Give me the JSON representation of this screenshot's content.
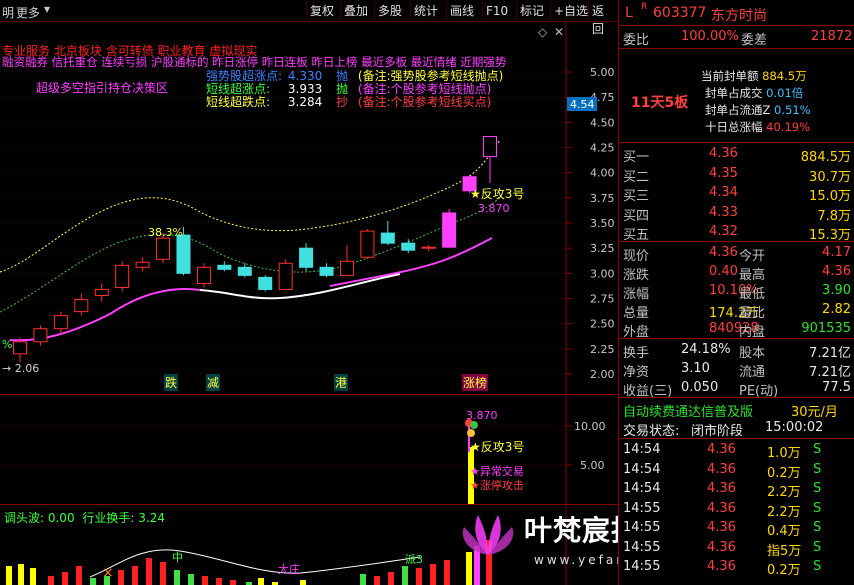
{
  "toolbar": {
    "left_labels": [
      "明",
      "更多"
    ],
    "buttons": [
      "复权",
      "叠加",
      "多股",
      "统计",
      "画线",
      "F10",
      "标记",
      "+自选",
      "返回"
    ]
  },
  "main_chart": {
    "tags": [
      "专业服务",
      "北京板块",
      "含可转债",
      "职业教育",
      "虚拟现实"
    ],
    "tags_line2": [
      "融资融券",
      "信托重仓",
      "连续亏损",
      "沪股通标的",
      "昨日涨停",
      "昨日连板",
      "昨日上榜",
      "最近多板",
      "最近情绪",
      "近期强势"
    ],
    "signals": [
      {
        "label": "强势股超涨点:",
        "value": "4.330",
        "action": "抛",
        "note": "(备注:强势股参考短线抛点)"
      },
      {
        "label": "短线超涨点:",
        "value": "3.933",
        "action": "抛",
        "note": "(备注:个股参考短线抛点)"
      },
      {
        "label": "短线超跌点:",
        "value": "3.284",
        "action": "抄",
        "note": "(备注:个股参考短线买点)"
      }
    ],
    "indicator_title": "超级多空指引持仓决策区",
    "price_marker": "4.54",
    "pct_label": "38.3%",
    "low_label": "2.06",
    "left_pct": "%",
    "fangong": "★反攻3号",
    "fangong_price": "3.870",
    "bottom_tags": [
      "跌",
      "减",
      "港",
      "涨榜"
    ],
    "y_ticks": [
      "5.00",
      "4.75",
      "4.50",
      "4.25",
      "4.00",
      "3.75",
      "3.50",
      "3.25",
      "3.00",
      "2.75",
      "2.50",
      "2.25",
      "2.00"
    ]
  },
  "chart_data": {
    "type": "candlestick",
    "ylim": [
      2.0,
      5.1
    ],
    "candles": [
      {
        "o": 2.2,
        "c": 2.32,
        "h": 2.36,
        "l": 2.12,
        "color": "red"
      },
      {
        "o": 2.32,
        "c": 2.45,
        "h": 2.48,
        "l": 2.28,
        "color": "red"
      },
      {
        "o": 2.45,
        "c": 2.58,
        "h": 2.62,
        "l": 2.4,
        "color": "red"
      },
      {
        "o": 2.62,
        "c": 2.74,
        "h": 2.8,
        "l": 2.58,
        "color": "red"
      },
      {
        "o": 2.78,
        "c": 2.84,
        "h": 2.9,
        "l": 2.72,
        "color": "red"
      },
      {
        "o": 2.86,
        "c": 3.08,
        "h": 3.12,
        "l": 2.82,
        "color": "red"
      },
      {
        "o": 3.06,
        "c": 3.11,
        "h": 3.16,
        "l": 3.02,
        "color": "red"
      },
      {
        "o": 3.14,
        "c": 3.35,
        "h": 3.4,
        "l": 3.1,
        "color": "red"
      },
      {
        "o": 3.38,
        "c": 3.0,
        "h": 3.46,
        "l": 2.98,
        "color": "cyan"
      },
      {
        "o": 2.9,
        "c": 3.06,
        "h": 3.1,
        "l": 2.86,
        "color": "red"
      },
      {
        "o": 3.08,
        "c": 3.04,
        "h": 3.12,
        "l": 3.02,
        "color": "cyan"
      },
      {
        "o": 3.06,
        "c": 2.98,
        "h": 3.1,
        "l": 2.96,
        "color": "cyan"
      },
      {
        "o": 2.96,
        "c": 2.84,
        "h": 2.98,
        "l": 2.82,
        "color": "cyan"
      },
      {
        "o": 2.84,
        "c": 3.1,
        "h": 3.14,
        "l": 2.84,
        "color": "red"
      },
      {
        "o": 3.25,
        "c": 3.06,
        "h": 3.3,
        "l": 3.02,
        "color": "cyan"
      },
      {
        "o": 3.06,
        "c": 2.98,
        "h": 3.1,
        "l": 2.96,
        "color": "cyan"
      },
      {
        "o": 2.98,
        "c": 3.12,
        "h": 3.28,
        "l": 2.98,
        "color": "red"
      },
      {
        "o": 3.16,
        "c": 3.42,
        "h": 3.44,
        "l": 3.14,
        "color": "red"
      },
      {
        "o": 3.4,
        "c": 3.3,
        "h": 3.52,
        "l": 3.28,
        "color": "cyan"
      },
      {
        "o": 3.3,
        "c": 3.23,
        "h": 3.34,
        "l": 3.2,
        "color": "cyan"
      },
      {
        "o": 3.25,
        "c": 3.26,
        "h": 3.28,
        "l": 3.22,
        "color": "red"
      },
      {
        "o": 3.26,
        "c": 3.6,
        "h": 3.64,
        "l": 3.26,
        "color": "magenta"
      },
      {
        "o": 3.82,
        "c": 3.96,
        "h": 3.98,
        "l": 3.8,
        "color": "magenta"
      },
      {
        "o": 4.16,
        "c": 4.36,
        "h": 4.36,
        "l": 3.9,
        "color": "magenta"
      }
    ]
  },
  "sub_chart": {
    "y_ticks": [
      "10.00",
      "5.00"
    ],
    "price": "3.870",
    "labels": [
      "★反攻3号",
      "★异常交易",
      "★涨停攻击"
    ]
  },
  "bottom_chart": {
    "title": "调头波: 0.00",
    "subtitle": "行业换手: 3.24",
    "labels": [
      "中",
      "大庄",
      "派3"
    ],
    "cross": "×"
  },
  "watermark": {
    "text": "叶梵宸指标公式网",
    "url": "www.yefanchen.com"
  },
  "quote": {
    "header": {
      "code": "603377",
      "name": "东方时尚",
      "l": "L",
      "r": "R"
    },
    "weibi_label": "委比",
    "weibi": "100.00%",
    "weicha_label": "委差",
    "weicha": "21872",
    "seal": [
      {
        "label": "当前封单额",
        "value": "884.5万"
      },
      {
        "label": "封单占成交",
        "value": "0.01倍"
      },
      {
        "label": "封单占流通Z",
        "value": "0.51%"
      },
      {
        "label": "十日总涨幅",
        "value": "40.19%"
      }
    ],
    "streak": "11天5板",
    "bids": [
      {
        "label": "买一",
        "price": "4.36",
        "vol": "884.5万"
      },
      {
        "label": "买二",
        "price": "4.35",
        "vol": "30.7万"
      },
      {
        "label": "买三",
        "price": "4.34",
        "vol": "15.0万"
      },
      {
        "label": "买四",
        "price": "4.33",
        "vol": "7.8万"
      },
      {
        "label": "买五",
        "price": "4.32",
        "vol": "15.3万"
      }
    ],
    "stats": [
      {
        "l1": "现价",
        "v1": "4.36",
        "l2": "今开",
        "v2": "4.17"
      },
      {
        "l1": "涨跌",
        "v1": "0.40",
        "l2": "最高",
        "v2": "4.36"
      },
      {
        "l1": "涨幅",
        "v1": "10.10%",
        "l2": "最低",
        "v2": "3.90"
      },
      {
        "l1": "总量",
        "v1": "174.2万",
        "l2": "量比",
        "v2": "2.82"
      },
      {
        "l1": "外盘",
        "v1": "840928",
        "l2": "内盘",
        "v2": "901535"
      }
    ],
    "stats2": [
      {
        "l1": "换手",
        "v1": "24.18%",
        "l2": "股本",
        "v2": "7.21亿"
      },
      {
        "l1": "净资",
        "v1": "3.10",
        "l2": "流通",
        "v2": "7.21亿"
      },
      {
        "l1": "收益(三)",
        "v1": "0.050",
        "l2": "PE(动)",
        "v2": "77.5"
      }
    ],
    "promo": "自动续费通达信普及版",
    "promo_price": "30元/月",
    "trade_status_label": "交易状态:",
    "trade_status": "闭市阶段",
    "trade_time": "15:00:02",
    "ticks": [
      {
        "t": "14:54",
        "p": "4.36",
        "v": "1.0万",
        "s": "S"
      },
      {
        "t": "14:54",
        "p": "4.36",
        "v": "0.2万",
        "s": "S"
      },
      {
        "t": "14:54",
        "p": "4.36",
        "v": "2.2万",
        "s": "S"
      },
      {
        "t": "14:55",
        "p": "4.36",
        "v": "2.2万",
        "s": "S"
      },
      {
        "t": "14:55",
        "p": "4.36",
        "v": "0.4万",
        "s": "S"
      },
      {
        "t": "14:55",
        "p": "4.36",
        "v": "指5万",
        "s": "S"
      },
      {
        "t": "14:55",
        "p": "4.36",
        "v": "0.2万",
        "s": "S"
      }
    ]
  }
}
